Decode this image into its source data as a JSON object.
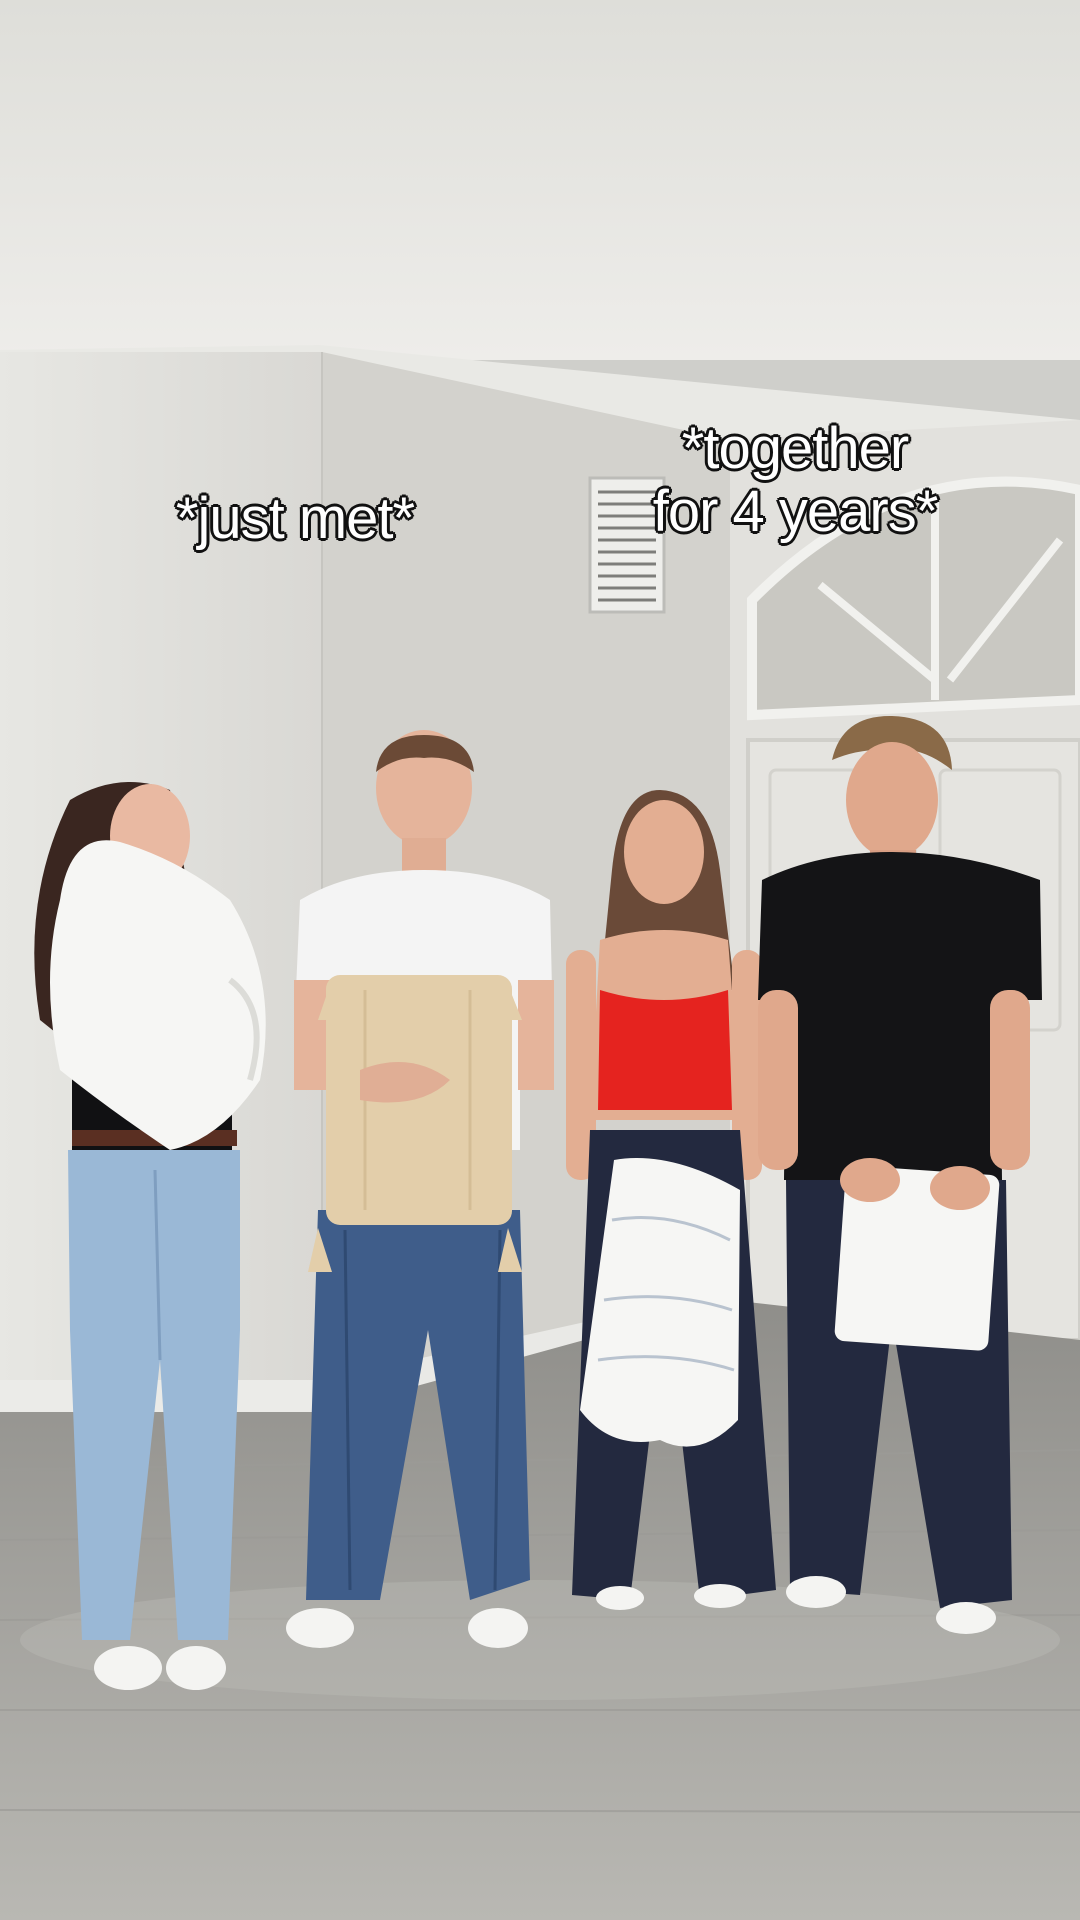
{
  "captions": {
    "left": "*just met*",
    "right_line1": "*together",
    "right_line2": "for 4 years*"
  },
  "colors": {
    "wall": "#dddcd7",
    "ceiling": "#e6e5e1",
    "floor": "#a9a8a3",
    "red_top": "#e5231f",
    "black_tee": "#141416",
    "navy_pants": "#23293f",
    "jeans_light": "#9ab8d6",
    "jeans_dark": "#3f5d8a",
    "beige_pillow": "#e3ceaa",
    "white_pillow": "#f6f6f4"
  }
}
